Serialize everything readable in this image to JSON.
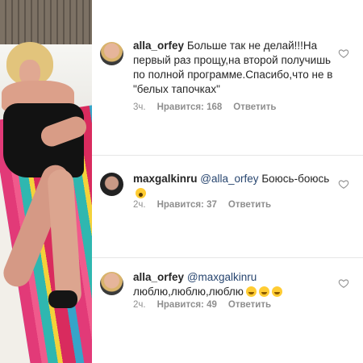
{
  "comments": [
    {
      "username": "alla_orfey",
      "mention": "",
      "text": "Больше так не делай!!!На первый раз прощу,на второй получишь по полной программе.Спасибо,что не в \"белых тапочках\"",
      "time": "3ч.",
      "likes": "Нравится: 168",
      "reply": "Ответить"
    },
    {
      "username": "maxgalkinru",
      "mention": "@alla_orfey",
      "text": "Боюсь-боюсь",
      "emoji": [
        "scream-emoji"
      ],
      "time": "2ч.",
      "likes": "Нравится: 37",
      "reply": "Ответить"
    },
    {
      "username": "alla_orfey",
      "mention": "@maxgalkinru",
      "text": "люблю,люблю,люблю",
      "emoji": [
        "grin-emoji",
        "grin-emoji",
        "grin-emoji"
      ],
      "time": "2ч.",
      "likes": "Нравится: 49",
      "reply": "Ответить"
    }
  ],
  "icons": {
    "like": "heart-outline-icon"
  },
  "colors": {
    "text": "#262626",
    "meta": "#8e8e8e",
    "mention": "#27456f"
  }
}
